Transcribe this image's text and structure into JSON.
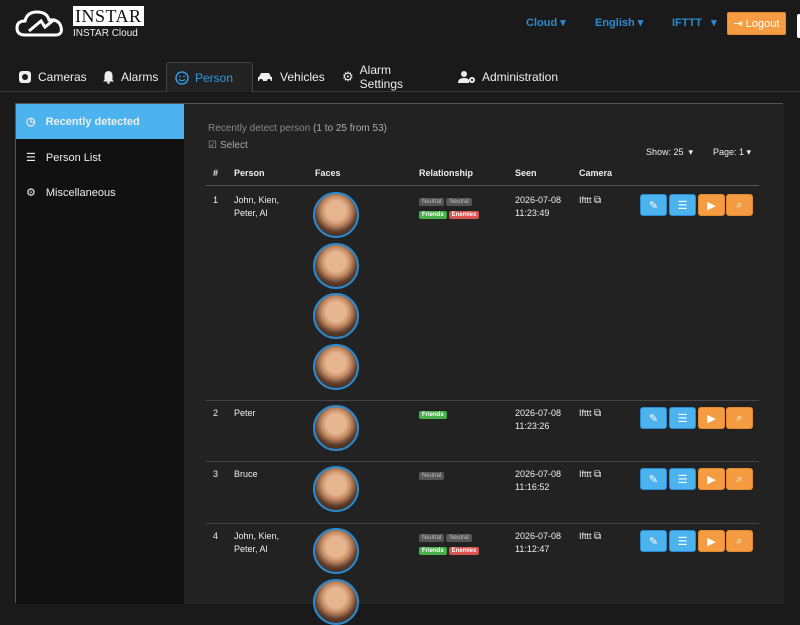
{
  "header": {
    "logo_word": "INSTAR",
    "logo_sub": "INSTAR Cloud",
    "dropdowns": [
      "Cloud",
      "English",
      "IFTTT"
    ],
    "logout": "Logout"
  },
  "tabs": [
    {
      "label": "Cameras",
      "icon": "camera-icon"
    },
    {
      "label": "Alarms",
      "icon": "bell-icon"
    },
    {
      "label": "Person",
      "icon": "smile-icon"
    },
    {
      "label": "Vehicles",
      "icon": "car-icon"
    },
    {
      "label": "Alarm Settings",
      "icon": "cogs-icon"
    },
    {
      "label": "Administration",
      "icon": "user-cog-icon"
    }
  ],
  "sidebar": [
    {
      "label": "Recently detected",
      "icon": "history-icon"
    },
    {
      "label": "Person List",
      "icon": "list-icon"
    },
    {
      "label": "Miscellaneous",
      "icon": "cogs-icon"
    }
  ],
  "content": {
    "caption_main": "Recently detect person",
    "caption_range": "(1 to 25 from 53)",
    "select_label": "Select",
    "show_label": "Show: 25",
    "page_label": "Page: 1",
    "columns": [
      "#",
      "Person",
      "Faces",
      "Relationship",
      "Seen",
      "Camera"
    ],
    "rows": [
      {
        "num": "1",
        "person1": "John, Kien,",
        "person2": "Peter, Al",
        "tags": [
          "Neutral",
          "Neutral",
          "Friends",
          "Enemies"
        ],
        "date": "2026-07-08",
        "time": "11:23:49",
        "camera": "Ifttt"
      },
      {
        "num": "2",
        "person1": "Peter",
        "person2": "",
        "tags": [
          "Friends"
        ],
        "date": "2026-07-08",
        "time": "11:23:26",
        "camera": "Ifttt"
      },
      {
        "num": "3",
        "person1": "Bruce",
        "person2": "",
        "tags": [
          "Neutral"
        ],
        "date": "2026-07-08",
        "time": "11:16:52",
        "camera": "Ifttt"
      },
      {
        "num": "4",
        "person1": "John, Kien,",
        "person2": "Peter, Al",
        "tags": [
          "Neutral",
          "Neutral",
          "Friends",
          "Enemies"
        ],
        "date": "2026-07-08",
        "time": "11:12:47",
        "camera": "Ifttt"
      }
    ]
  },
  "colors": {
    "accent": "#4db3ef",
    "orange": "#f59c42",
    "friends": "#46b04a",
    "enemies": "#d9534f"
  }
}
